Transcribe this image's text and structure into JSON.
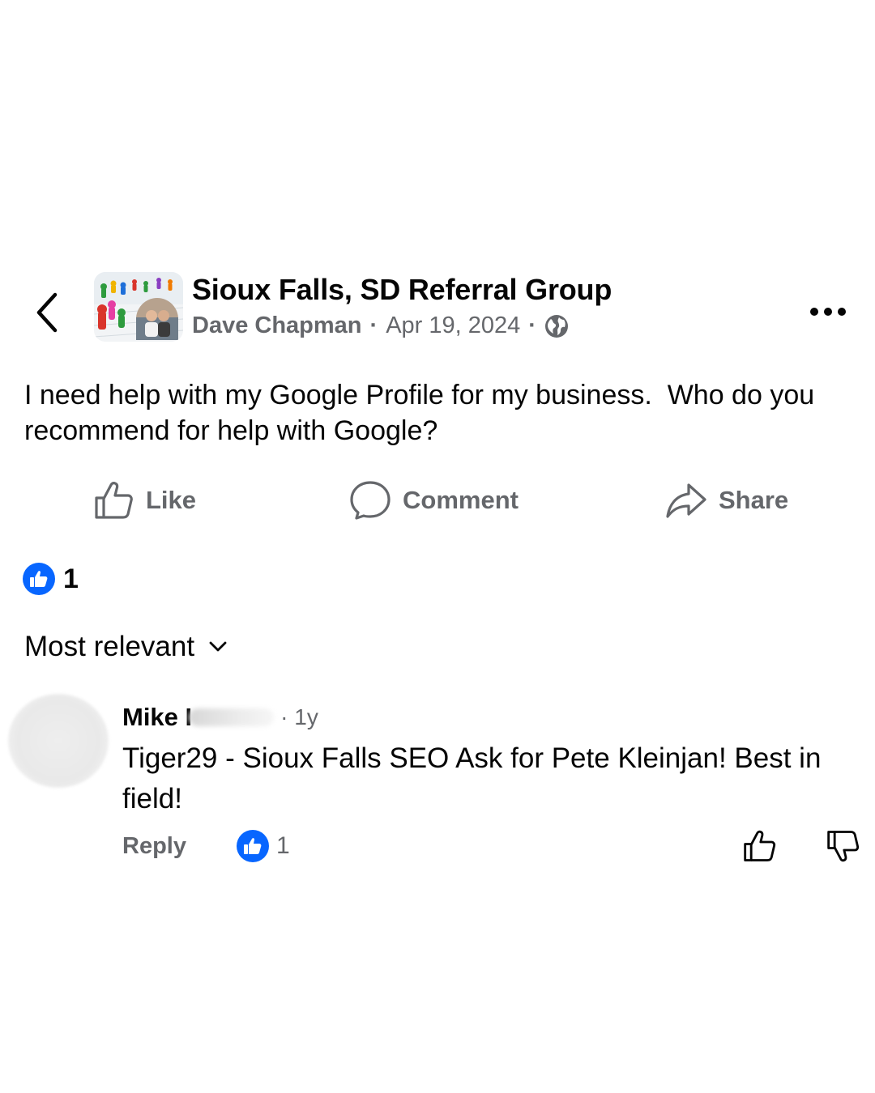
{
  "header": {
    "group_name": "Sioux Falls, SD Referral Group",
    "author": "Dave Chapman",
    "separator": "·",
    "date": "Apr 19, 2024",
    "visibility_icon": "globe-icon",
    "back_icon": "chevron-left-icon",
    "more_icon": "more-options-icon"
  },
  "post": {
    "text": "I need help with my Google Profile for my business.  Who do you recommend for help with Google?"
  },
  "actions": {
    "like_label": "Like",
    "comment_label": "Comment",
    "share_label": "Share"
  },
  "reactions": {
    "count": "1",
    "icon": "thumbs-up-icon"
  },
  "sort": {
    "label": "Most relevant",
    "icon": "chevron-down-icon"
  },
  "comments": [
    {
      "author": "Mike I",
      "separator": "·",
      "time": "1y",
      "text": "Tiger29 - Sioux Falls SEO Ask for Pete Kleinjan! Best in field!",
      "reply_label": "Reply",
      "reaction_count": "1"
    }
  ],
  "colors": {
    "accent": "#0866ff",
    "secondary_text": "#65676b",
    "primary_text": "#050505"
  }
}
